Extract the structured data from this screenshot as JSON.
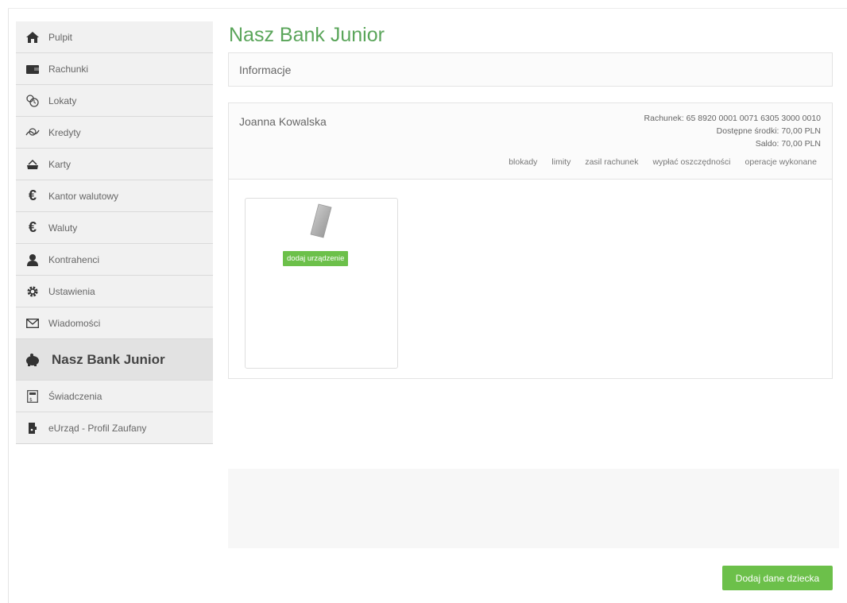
{
  "sidebar": {
    "items": [
      {
        "label": "Pulpit",
        "icon": "home-icon"
      },
      {
        "label": "Rachunki",
        "icon": "wallet-icon"
      },
      {
        "label": "Lokaty",
        "icon": "deposit-icon"
      },
      {
        "label": "Kredyty",
        "icon": "credit-icon"
      },
      {
        "label": "Karty",
        "icon": "card-icon"
      },
      {
        "label": "Kantor walutowy",
        "icon": "euro-icon"
      },
      {
        "label": "Waluty",
        "icon": "euro-icon"
      },
      {
        "label": "Kontrahenci",
        "icon": "person-icon"
      },
      {
        "label": "Ustawienia",
        "icon": "gear-icon"
      },
      {
        "label": "Wiadomości",
        "icon": "envelope-icon"
      },
      {
        "label": "Nasz Bank Junior",
        "icon": "piggy-bank-icon",
        "active": true
      },
      {
        "label": "Świadczenia",
        "icon": "benefits-icon"
      },
      {
        "label": "eUrząd - Profil Zaufany",
        "icon": "profile-icon"
      }
    ]
  },
  "main": {
    "title": "Nasz Bank Junior",
    "info_panel": "Informacje",
    "account": {
      "owner": "Joanna Kowalska",
      "number": "Rachunek: 65 8920 0001 0071 6305 3000 0010",
      "available": "Dostępne środki: 70,00 PLN",
      "balance": "Saldo: 70,00 PLN",
      "tabs": [
        "blokady",
        "limity",
        "zasil rachunek",
        "wypłać oszczędności",
        "operacje wykonane"
      ]
    },
    "device_card": {
      "button": "dodaj urządzenie"
    },
    "add_child_button": "Dodaj dane dziecka"
  },
  "colors": {
    "accent": "#6cc04a",
    "title": "#5aa55a",
    "sidebar_bg": "#f1f1f1",
    "sidebar_active_bg": "#e2e2e2"
  }
}
